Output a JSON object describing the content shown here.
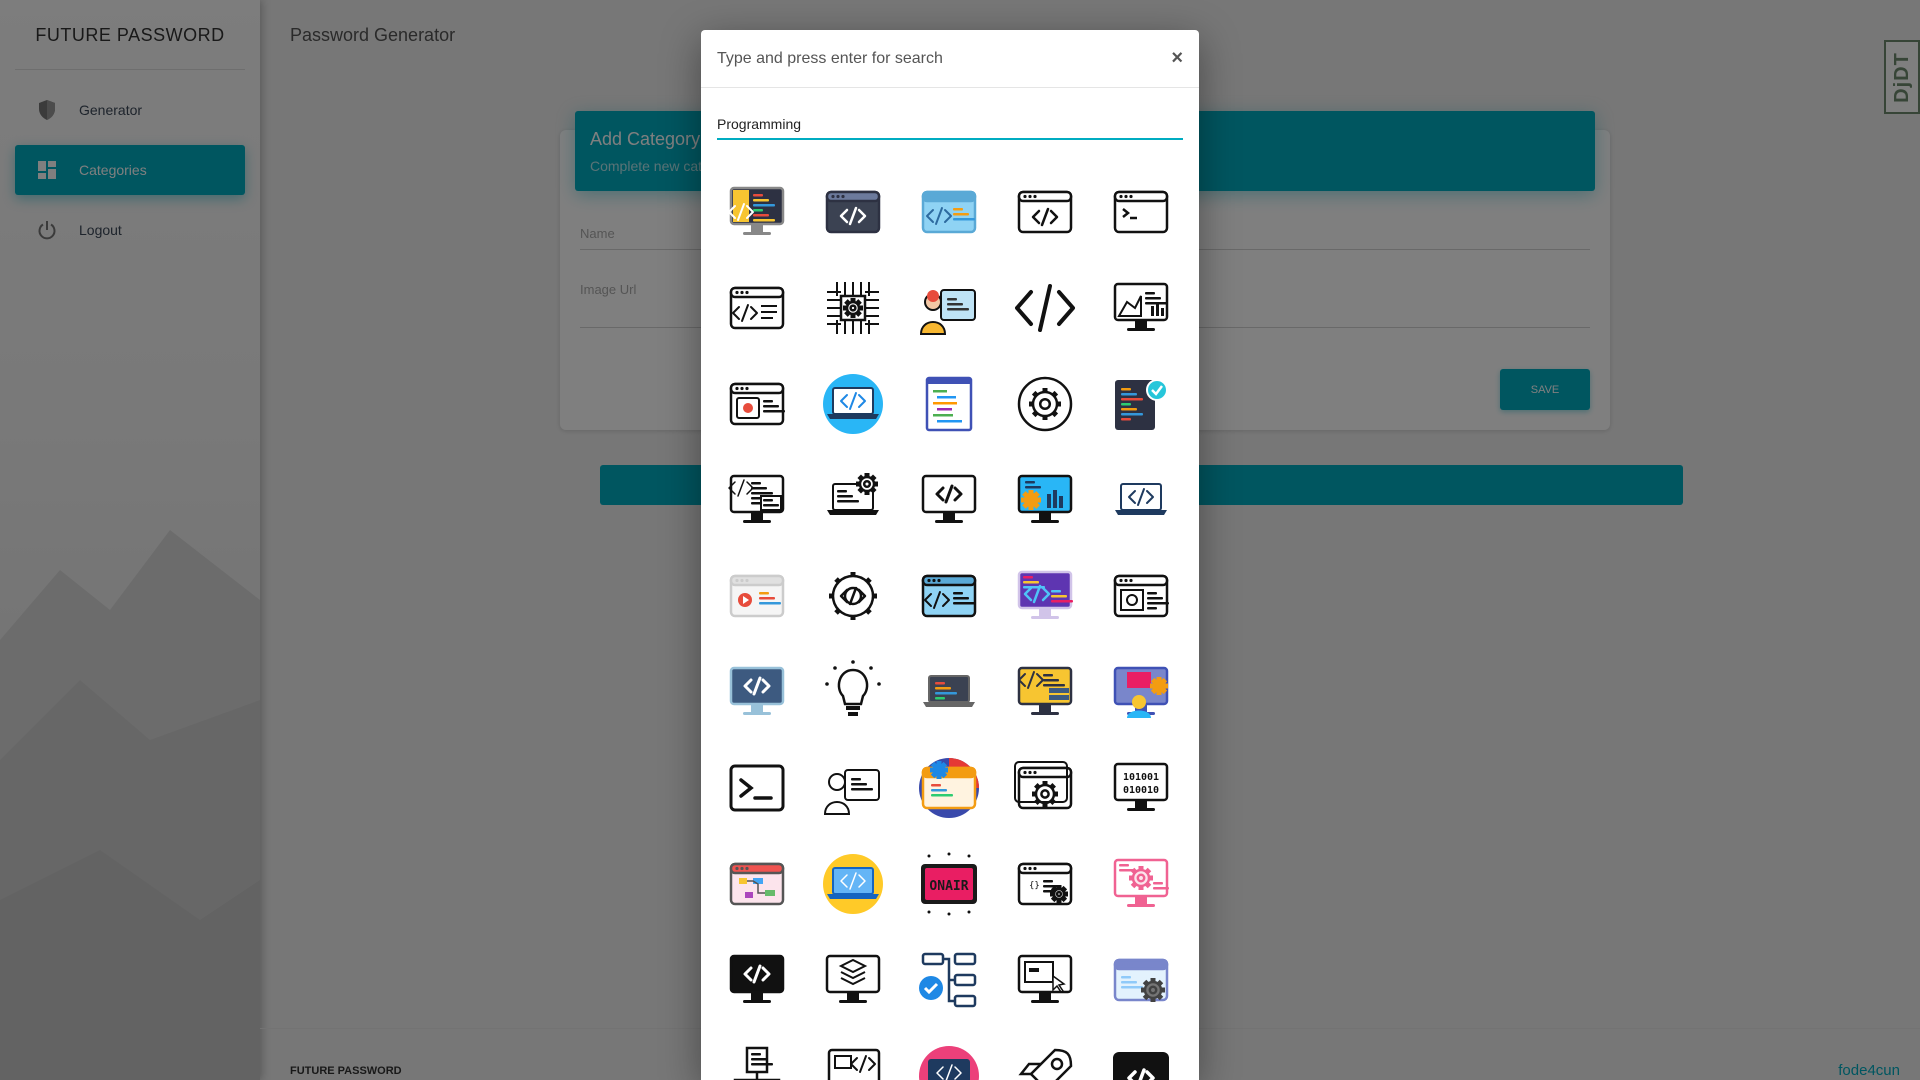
{
  "app": {
    "brand": "FUTURE PASSWORD",
    "page_title": "Password Generator"
  },
  "sidebar": {
    "items": [
      {
        "label": "Generator",
        "icon": "shield-icon",
        "active": false
      },
      {
        "label": "Categories",
        "icon": "dashboard-icon",
        "active": true
      },
      {
        "label": "Logout",
        "icon": "power-icon",
        "active": false
      }
    ]
  },
  "form": {
    "header_title": "Add Category",
    "header_subtitle": "Complete new category",
    "name_label": "Name",
    "image_url_label": "Image Url",
    "save_label": "SAVE"
  },
  "footer": {
    "left": "FUTURE PASSWORD",
    "right": "fode4cun"
  },
  "debug_toolbar": {
    "label": "DjDT"
  },
  "modal": {
    "title": "Type and press enter for search",
    "close": "×",
    "search_value": "Programming",
    "icons": [
      "monitor-code-color-icon",
      "browser-code-dark-icon",
      "browser-code-blue-icon",
      "browser-code-outline-icon",
      "terminal-window-icon",
      "browser-code-lines-icon",
      "chip-gear-icon",
      "developer-person-color-icon",
      "code-brackets-icon",
      "monitor-chart-outline-icon",
      "browser-video-icon",
      "laptop-circle-blue-icon",
      "document-code-blue-icon",
      "gear-circle-icon",
      "code-file-check-icon",
      "monitor-code-list-icon",
      "laptop-gear-icon",
      "monitor-code-bold-icon",
      "monitor-gear-chart-color-icon",
      "laptop-code-flat-icon",
      "browser-video-color-icon",
      "gear-code-icon",
      "browser-code-blue-dark-icon",
      "monitor-code-purple-icon",
      "browser-video-lines-icon",
      "monitor-code-flat-icon",
      "lightbulb-icon",
      "laptop-dark-code-icon",
      "monitor-code-stack-icon",
      "developer-monitor-color-icon",
      "terminal-prompt-icon",
      "developer-person-outline-icon",
      "gear-circle-purple-icon",
      "browser-gear-icon",
      "monitor-binary-icon",
      "browser-flowchart-icon",
      "laptop-circle-yellow-icon",
      "on-air-sign-icon",
      "browser-settings-list-icon",
      "monitor-gear-pink-icon",
      "monitor-code-black-icon",
      "monitor-layers-icon",
      "flowchart-check-icon",
      "monitor-cursor-icon",
      "browser-gear-blue-icon",
      "network-document-icon",
      "browser-code-box-icon",
      "laptop-circle-pink-icon",
      "rocket-icon",
      "code-window-black-icon"
    ]
  },
  "colors": {
    "accent": "#00acc1",
    "overlay": "rgba(0,0,0,0.5)"
  }
}
